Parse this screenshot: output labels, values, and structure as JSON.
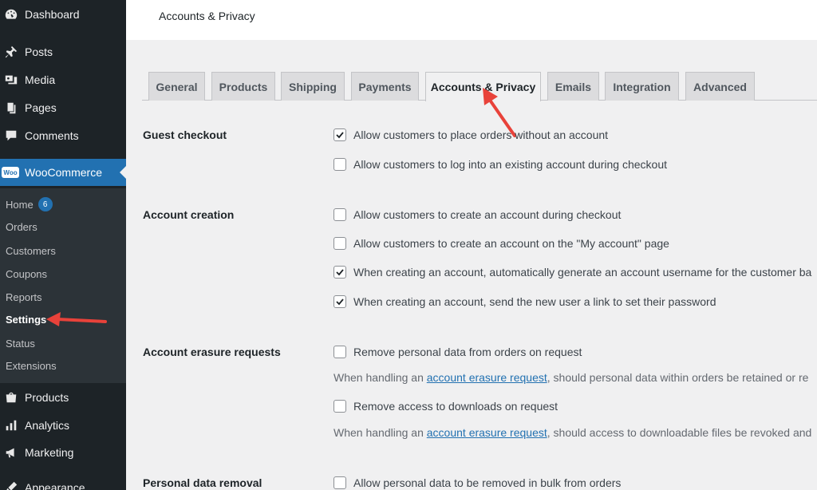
{
  "sidebar": {
    "menu": [
      {
        "label": "Dashboard",
        "icon": "dashboard-icon"
      },
      {
        "label": "Posts",
        "icon": "pin-icon"
      },
      {
        "label": "Media",
        "icon": "media-icon"
      },
      {
        "label": "Pages",
        "icon": "pages-icon"
      },
      {
        "label": "Comments",
        "icon": "comment-icon"
      }
    ],
    "woocommerce": {
      "label": "WooCommerce",
      "logo_text": "Woo"
    },
    "submenu": [
      {
        "label": "Home",
        "badge": "6"
      },
      {
        "label": "Orders"
      },
      {
        "label": "Customers"
      },
      {
        "label": "Coupons"
      },
      {
        "label": "Reports"
      },
      {
        "label": "Settings"
      },
      {
        "label": "Status"
      },
      {
        "label": "Extensions"
      }
    ],
    "menu_bottom": [
      {
        "label": "Products",
        "icon": "products-icon"
      },
      {
        "label": "Analytics",
        "icon": "analytics-icon"
      },
      {
        "label": "Marketing",
        "icon": "megaphone-icon"
      },
      {
        "label": "Appearance",
        "icon": "appearance-icon"
      }
    ]
  },
  "header": {
    "title": "Accounts & Privacy"
  },
  "tabs": [
    "General",
    "Products",
    "Shipping",
    "Payments",
    "Accounts & Privacy",
    "Emails",
    "Integration",
    "Advanced"
  ],
  "active_tab": "Accounts & Privacy",
  "sections": {
    "guest_checkout": {
      "label": "Guest checkout",
      "options": [
        {
          "text": "Allow customers to place orders without an account",
          "checked": true
        },
        {
          "text": "Allow customers to log into an existing account during checkout",
          "checked": false
        }
      ]
    },
    "account_creation": {
      "label": "Account creation",
      "options": [
        {
          "text": "Allow customers to create an account during checkout",
          "checked": false
        },
        {
          "text": "Allow customers to create an account on the \"My account\" page",
          "checked": false
        },
        {
          "text": "When creating an account, automatically generate an account username for the customer ba",
          "checked": true
        },
        {
          "text": "When creating an account, send the new user a link to set their password",
          "checked": true
        }
      ]
    },
    "erasure": {
      "label": "Account erasure requests",
      "options": [
        {
          "text": "Remove personal data from orders on request",
          "checked": false
        },
        {
          "text": "Remove access to downloads on request",
          "checked": false
        }
      ],
      "desc1": {
        "before": "When handling an ",
        "link": "account erasure request",
        "after": ", should personal data within orders be retained or re"
      },
      "desc2": {
        "before": "When handling an ",
        "link": "account erasure request",
        "after": ", should access to downloadable files be revoked and"
      }
    },
    "removal": {
      "label": "Personal data removal",
      "options": [
        {
          "text": "Allow personal data to be removed in bulk from orders",
          "checked": false
        }
      ]
    }
  },
  "colors": {
    "accent": "#2271b1",
    "sidebar": "#1d2327",
    "arrow": "#e8423a"
  }
}
